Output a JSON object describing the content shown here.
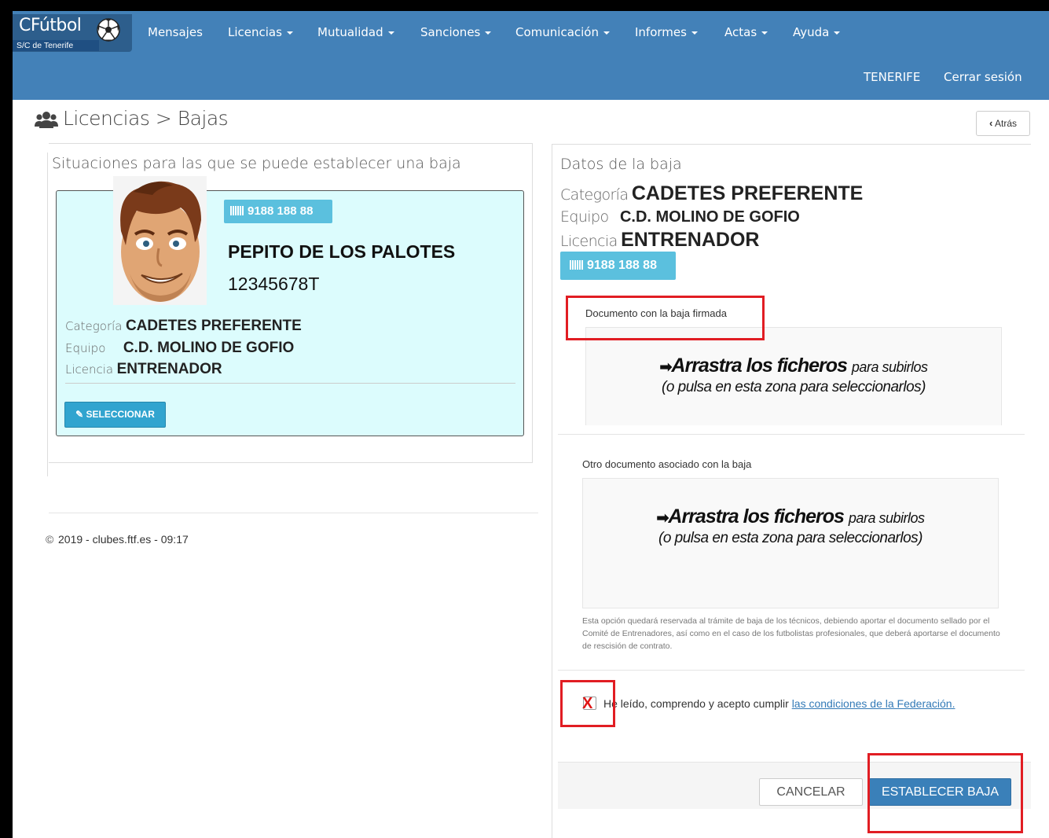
{
  "brand": {
    "name": "CFútbol",
    "subtitle": "S/C de Tenerife"
  },
  "nav": {
    "items": [
      {
        "label": "Mensajes",
        "dropdown": false
      },
      {
        "label": "Licencias",
        "dropdown": true
      },
      {
        "label": "Mutualidad",
        "dropdown": true
      },
      {
        "label": "Sanciones",
        "dropdown": true
      },
      {
        "label": "Comunicación",
        "dropdown": true
      },
      {
        "label": "Informes",
        "dropdown": true
      },
      {
        "label": "Actas",
        "dropdown": true
      },
      {
        "label": "Ayuda",
        "dropdown": true
      }
    ],
    "region": "TENERIFE",
    "logout": "Cerrar sesión"
  },
  "page": {
    "title": "Licencias > Bajas",
    "back": "Atrás"
  },
  "left": {
    "heading": "Situaciones para las que se puede establecer una baja",
    "card": {
      "badge": "9188 188  88",
      "name": "PEPITO DE LOS PALOTES",
      "id": "12345678T",
      "categoria_label": "Categoría",
      "categoria": "CADETES PREFERENTE",
      "equipo_label": "Equipo",
      "equipo": "C.D. MOLINO DE GOFIO",
      "licencia_label": "Licencia",
      "licencia": "ENTRENADOR",
      "select_button": "SELECCIONAR"
    },
    "footer": "2019 - clubes.ftf.es - 09:17"
  },
  "right": {
    "heading": "Datos de la baja",
    "categoria_label": "Categoría",
    "categoria": "CADETES PREFERENTE",
    "equipo_label": "Equipo",
    "equipo": "C.D. MOLINO DE GOFIO",
    "licencia_label": "Licencia",
    "licencia": "ENTRENADOR",
    "badge": "9188 188  88",
    "doc1_label": "Documento con la baja firmada",
    "doc2_label": "Otro documento asociado con la baja",
    "dropzone": {
      "main": "Arrastra los ficheros",
      "rest": "para subirlos",
      "sub": "(o pulsa en esta zona para seleccionarlos)"
    },
    "help": "Esta opción quedará reservada al trámite de baja de los técnicos, debiendo aportar el documento sellado por el Comité de Entrenadores, así como en el caso de los futbolistas profesionales, que deberá aportarse el documento de rescisión de contrato.",
    "terms_text": "He leído, comprendo y acepto cumplir",
    "terms_link": "las condiciones de la Federación.",
    "checkbox_mark": "X",
    "cancel": "CANCELAR",
    "confirm": "ESTABLECER BAJA"
  },
  "colors": {
    "navbar": "#4381b8",
    "card": "#dcfcfd",
    "badge": "#5bc0de",
    "primary": "#3a80b9",
    "highlight": "#e11d23"
  }
}
